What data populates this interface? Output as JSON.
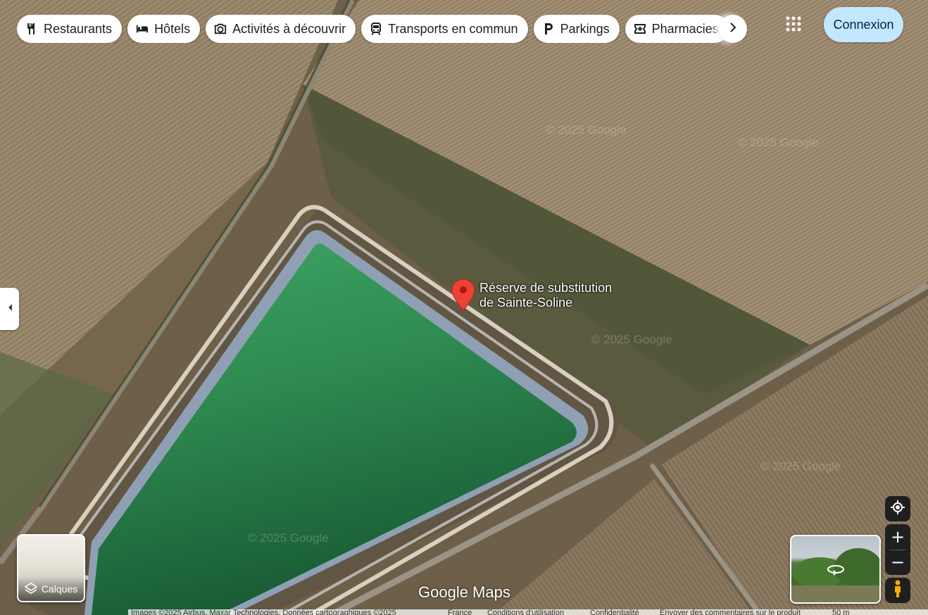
{
  "categories": [
    {
      "label": "Restaurants",
      "icon": "fork-knife-icon"
    },
    {
      "label": "Hôtels",
      "icon": "bed-icon"
    },
    {
      "label": "Activités à découvrir",
      "icon": "camera-icon"
    },
    {
      "label": "Transports en commun",
      "icon": "train-icon"
    },
    {
      "label": "Parkings",
      "icon": "parking-icon"
    },
    {
      "label": "Pharmacies",
      "icon": "pharmacy-icon"
    }
  ],
  "header": {
    "signin_label": "Connexion",
    "apps_icon": "apps-grid-icon",
    "next_icon": "chevron-right-icon"
  },
  "sidebar_toggle_icon": "chevron-left-icon",
  "place": {
    "name_line1": "Réserve de substitution",
    "name_line2": "de Sainte-Soline",
    "pin_color": "#ea4335"
  },
  "layers": {
    "label": "Calques",
    "icon": "layers-icon"
  },
  "branding": {
    "watermark": "Google Maps",
    "imagery_watermark": "© 2025 Google"
  },
  "controls": {
    "locate_icon": "my-location-icon",
    "zoom_in": "+",
    "zoom_out": "−",
    "pegman_icon": "pegman-icon",
    "streetview_icon": "360-rotate-icon"
  },
  "footer": {
    "attribution": "Images ©2025 Airbus, Maxar Technologies, Données cartographiques ©2025",
    "country": "France",
    "terms": "Conditions d'utilisation",
    "privacy": "Confidentialité",
    "feedback": "Envoyer des commentaires sur le produit",
    "scale": "50 m"
  },
  "map_type": "satellite"
}
